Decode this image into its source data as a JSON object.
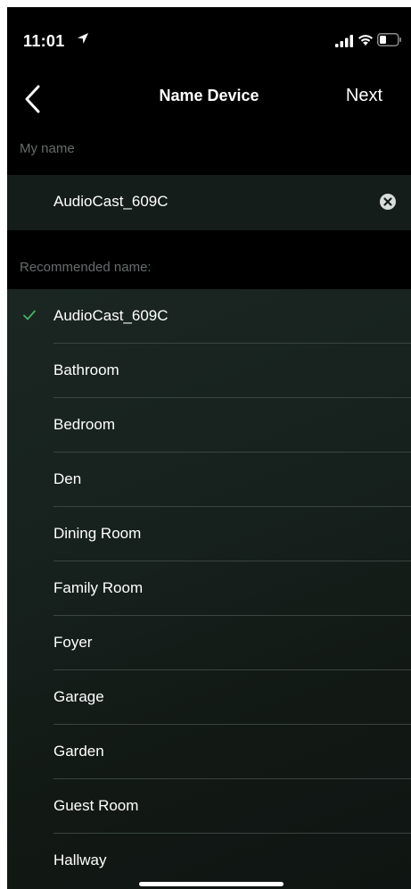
{
  "status_bar": {
    "time": "11:01"
  },
  "nav": {
    "title": "Name Device",
    "next_label": "Next"
  },
  "my_name": {
    "label": "My name",
    "value": "AudioCast_609C"
  },
  "recommended": {
    "label": "Recommended name:",
    "selected_index": 0,
    "items": [
      "AudioCast_609C",
      "Bathroom",
      "Bedroom",
      "Den",
      "Dining Room",
      "Family Room",
      "Foyer",
      "Garage",
      "Garden",
      "Guest Room",
      "Hallway"
    ]
  },
  "icons": {
    "back": "chevron-left-icon",
    "clear": "clear-circle-icon",
    "check": "checkmark-icon",
    "location": "location-arrow-icon",
    "signal": "cellular-signal-icon",
    "wifi": "wifi-icon",
    "battery": "battery-icon"
  },
  "colors": {
    "accent_check": "#4cae62",
    "background": "#000000",
    "field_bg": "#141d1a",
    "section_label": "#666c6c"
  }
}
